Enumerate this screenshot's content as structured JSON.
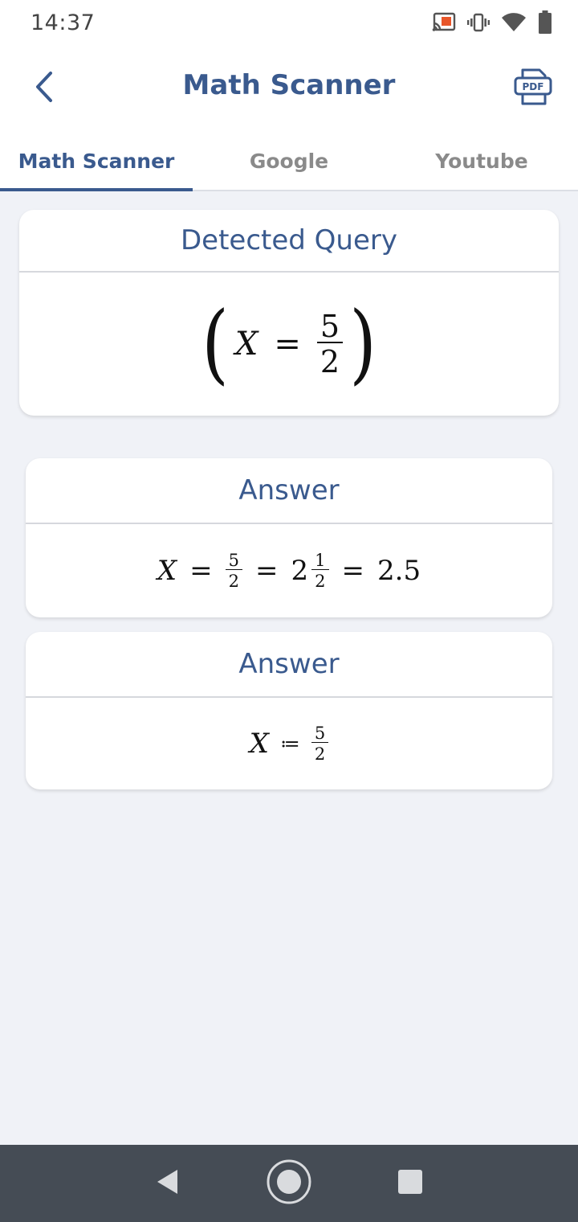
{
  "status_bar": {
    "time": "14:37",
    "icons": [
      "cast-icon",
      "vibrate-icon",
      "wifi-icon",
      "battery-icon"
    ]
  },
  "header": {
    "title": "Math Scanner",
    "back_icon": "chevron-left-icon",
    "pdf_label": "PDF"
  },
  "tabs": [
    {
      "label": "Math Scanner",
      "active": true
    },
    {
      "label": "Google",
      "active": false
    },
    {
      "label": "Youtube",
      "active": false
    }
  ],
  "detected_query": {
    "title": "Detected Query",
    "expression": {
      "var": "X",
      "op": "=",
      "num": "5",
      "den": "2"
    }
  },
  "answers": [
    {
      "title": "Answer",
      "expression": {
        "var": "X",
        "op1": "=",
        "f1_num": "5",
        "f1_den": "2",
        "op2": "=",
        "whole": "2",
        "f2_num": "1",
        "f2_den": "2",
        "op3": "=",
        "decimal": "2.5"
      }
    },
    {
      "title": "Answer",
      "expression": {
        "var": "X",
        "op": "≔",
        "num": "5",
        "den": "2"
      }
    }
  ],
  "colors": {
    "accent": "#3a5a8e",
    "background": "#f0f2f7",
    "nav_bar": "#454c55"
  }
}
